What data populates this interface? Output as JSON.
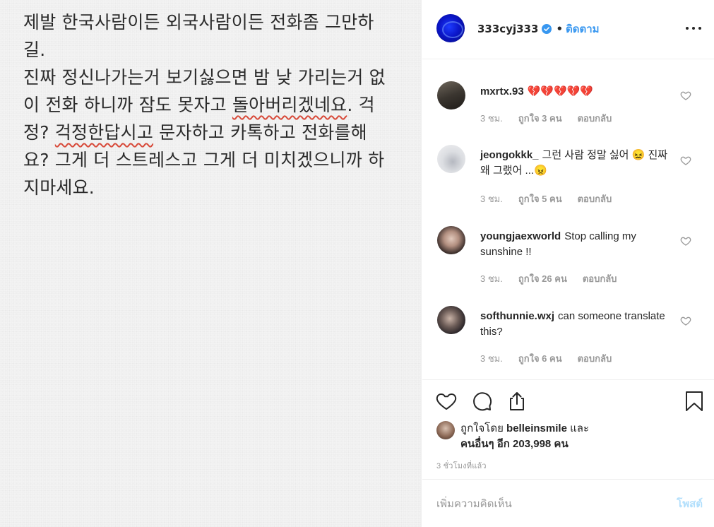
{
  "post": {
    "line1": "제발 한국사람이든 외국사람이든 전화좀 그만하",
    "line2": "길.",
    "line3": "진짜 정신나가는거 보기싫으면 밤 낮 가리는거 없",
    "line4_a": "이 전화 하니까 잠도 못자고 ",
    "line4_spell": "돌아버리겠네요",
    "line4_b": ". 걱",
    "line5_a": "정? ",
    "line5_spell": "걱정한답시고",
    "line5_b": " 문자하고 카톡하고 전화를해",
    "line6": "요? 그게 더 스트레스고 그게 더 미치겠으니까 하",
    "line7": "지마세요."
  },
  "header": {
    "username": "333cyj333",
    "dot": "•",
    "follow": "ติดตาม",
    "more_icon": "more-horizontal-icon"
  },
  "comments": [
    {
      "user": "mxrtx.93",
      "text": "💔💔💔💔💔",
      "time": "3 ชม.",
      "likes": "ถูกใจ 3 คน",
      "reply": "ตอบกลับ"
    },
    {
      "user": "jeongokkk_",
      "text": "그런 사람 정말 싫어 😖 진짜 왜 그랬어 ...😠",
      "time": "3 ชม.",
      "likes": "ถูกใจ 5 คน",
      "reply": "ตอบกลับ"
    },
    {
      "user": "youngjaexworld",
      "text": "Stop calling my sunshine !!",
      "time": "3 ชม.",
      "likes": "ถูกใจ 26 คน",
      "reply": "ตอบกลับ"
    },
    {
      "user": "softhunnie.wxj",
      "text": "can someone translate this?",
      "time": "3 ชม.",
      "likes": "ถูกใจ 6 คน",
      "reply": "ตอบกลับ"
    }
  ],
  "actions": {
    "liked_prefix": "ถูกใจโดย ",
    "liked_user": "belleinsmile",
    "liked_and": " และ",
    "liked_others": "คนอื่นๆ อีก 203,998 คน",
    "timestamp": "3 ชั่วโมงที่แล้ว"
  },
  "add_comment": {
    "placeholder": "เพิ่มความคิดเห็น",
    "post_label": "โพสต์"
  },
  "colors": {
    "accent": "#3897f0",
    "post_disabled": "#b2dffc",
    "broken_heart": "#d4202e",
    "spellcheck": "#d84a3a"
  }
}
